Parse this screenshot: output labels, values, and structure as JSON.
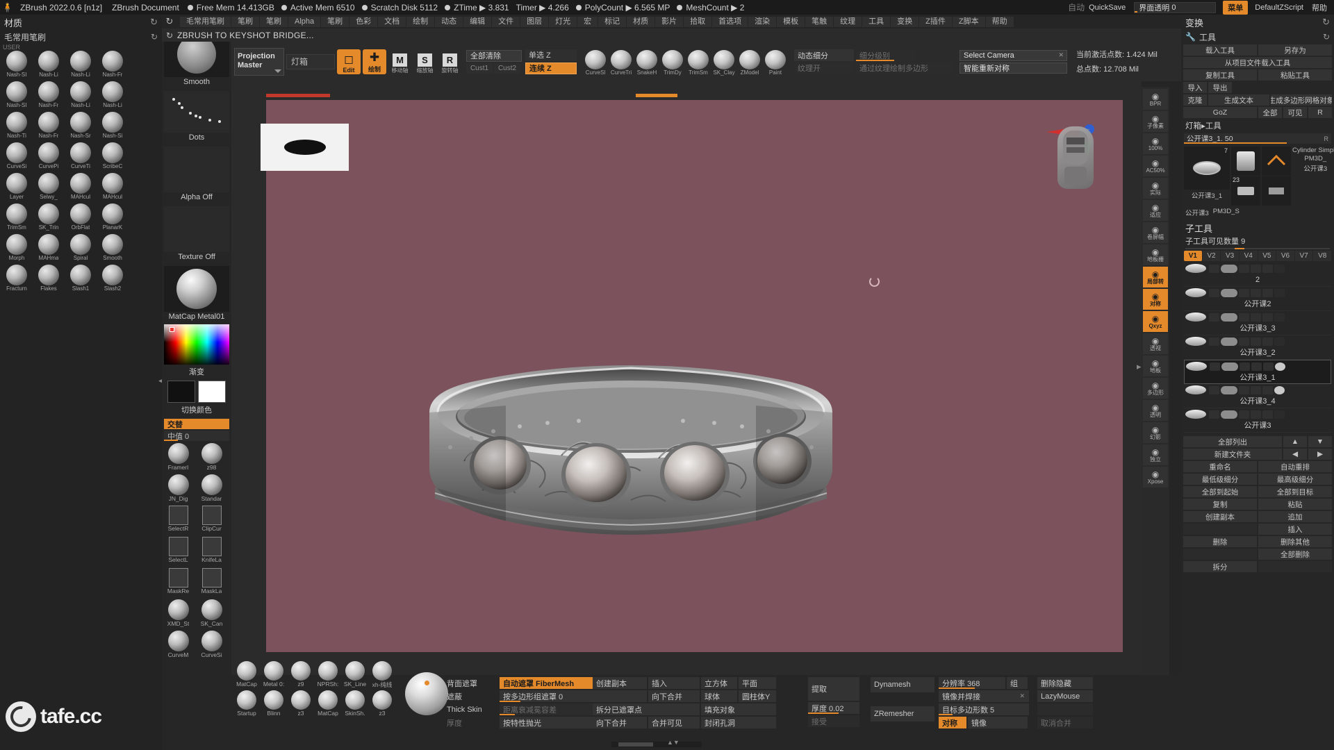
{
  "titlebar": {
    "logo_icon": "zbrush-logo-icon",
    "app_version": "ZBrush 2022.0.6 [n1z]",
    "document_name": "ZBrush Document",
    "stats": [
      {
        "label": "Free Mem",
        "value": "14.413GB"
      },
      {
        "label": "Active Mem",
        "value": "6510"
      },
      {
        "label": "Scratch Disk",
        "value": "5112"
      },
      {
        "label": "ZTime",
        "value": "3.831"
      },
      {
        "label": "Timer",
        "value": "4.266"
      },
      {
        "label": "PolyCount",
        "value": "6.565 MP"
      },
      {
        "label": "MeshCount",
        "value": "2"
      }
    ],
    "auto_label": "自动",
    "quicksave_label": "QuickSave",
    "transparency_label": "界面透明",
    "transparency_value": "0",
    "menu_button": "菜单",
    "default_script": "DefaultZScript",
    "help_label": "帮助"
  },
  "menubar": {
    "reload_icon": "reload-icon",
    "items": [
      "毛常用笔刷",
      "笔刷",
      "笔刷",
      "Alpha",
      "笔刷",
      "色彩",
      "文档",
      "绘制",
      "动态",
      "编辑",
      "文件",
      "图层",
      "灯光",
      "宏",
      "标记",
      "材质",
      "影片",
      "拾取",
      "首选项",
      "渲染",
      "模板",
      "笔触",
      "纹理",
      "工具",
      "变换",
      "Z插件",
      "Z脚本",
      "帮助"
    ]
  },
  "left_panel": {
    "header_title": "材质",
    "header_spin_icon": "refresh-icon",
    "sub_title": "毛常用笔刷",
    "sub_spin_icon": "refresh-icon",
    "user_label": "USER",
    "brushes": [
      {
        "label": "Nash-SI",
        "shape": "sphere"
      },
      {
        "label": "Nash-Li",
        "shape": "sphere"
      },
      {
        "label": "Nash-Li",
        "shape": "sphere"
      },
      {
        "label": "Nash-Fr",
        "shape": "sphere"
      },
      {
        "label": "Nash-SI",
        "shape": "sphere"
      },
      {
        "label": "Nash-Fr",
        "shape": "sphere"
      },
      {
        "label": "Nash-Li",
        "shape": "sphere"
      },
      {
        "label": "Nash-Li",
        "shape": "sphere"
      },
      {
        "label": "Nash-Ti",
        "shape": "sphere"
      },
      {
        "label": "Nash-Fr",
        "shape": "sphere"
      },
      {
        "label": "Nash-Sr",
        "shape": "sphere"
      },
      {
        "label": "Nash-Si",
        "shape": "sphere"
      },
      {
        "label": "CurveSi",
        "shape": "sphere"
      },
      {
        "label": "CurvePi",
        "shape": "sphere"
      },
      {
        "label": "CurveTi",
        "shape": "sphere"
      },
      {
        "label": "ScribeC",
        "shape": "sphere"
      },
      {
        "label": "Layer",
        "shape": "sphere"
      },
      {
        "label": "Selwy_",
        "shape": "sphere"
      },
      {
        "label": "MAHcul",
        "shape": "sphere"
      },
      {
        "label": "MAHcul",
        "shape": "sphere"
      },
      {
        "label": "TrimSm",
        "shape": "sphere"
      },
      {
        "label": "SK_Trin",
        "shape": "sphere"
      },
      {
        "label": "OrbFlat",
        "shape": "sphere"
      },
      {
        "label": "PlanarK",
        "shape": "sphere"
      },
      {
        "label": "Morph",
        "shape": "sphere"
      },
      {
        "label": "MAHma",
        "shape": "sphere"
      },
      {
        "label": "Spiral",
        "shape": "sphere"
      },
      {
        "label": "Smooth",
        "shape": "sphere"
      },
      {
        "label": "Fracturn",
        "shape": "sphere"
      },
      {
        "label": "Flakes",
        "shape": "sphere"
      },
      {
        "label": "Slash1",
        "shape": "sphere"
      },
      {
        "label": "Slash2",
        "shape": "sphere"
      }
    ]
  },
  "tool_col": {
    "smooth_label": "Smooth",
    "dots_label": "Dots",
    "alpha_label": "Alpha Off",
    "texture_label": "Texture Off",
    "matcap_label": "MatCap Metal01",
    "gradient_label": "渐变",
    "switch_color_label": "切换颜色",
    "alternate_label": "交替",
    "mid_label": "中值 0",
    "small_items": [
      {
        "label": "FramerI",
        "shape": "sphere"
      },
      {
        "label": "z98",
        "shape": "sphere"
      },
      {
        "label": "JN_Dig",
        "shape": "sphere"
      },
      {
        "label": "Standar",
        "shape": "sphere"
      },
      {
        "label": "SelectR",
        "shape": "square"
      },
      {
        "label": "ClipCur",
        "shape": "square"
      },
      {
        "label": "SelectL",
        "shape": "square"
      },
      {
        "label": "KnifeLa",
        "shape": "square"
      },
      {
        "label": "MaskRe",
        "shape": "square"
      },
      {
        "label": "MaskLa",
        "shape": "square"
      },
      {
        "label": "XMD_St",
        "shape": "sphere"
      },
      {
        "label": "SK_Can",
        "shape": "sphere"
      },
      {
        "label": "CurveM",
        "shape": "sphere"
      },
      {
        "label": "CurveSi",
        "shape": "sphere"
      }
    ]
  },
  "toolbar2": {
    "subhead_text": "ZBRUSH TO KEYSHOT BRIDGE...",
    "reload_icon": "reload-icon",
    "projection_master": "Projection\nMaster",
    "lightbox_label": "灯箱",
    "edit_label": "Edit",
    "draw_label": "绘制",
    "move_label": "移动轴",
    "scale_label": "缩放轴",
    "rotate_label": "旋转轴",
    "move_glyph": "M",
    "scale_glyph": "S",
    "rotate_glyph": "R",
    "clear_all": "全部清除",
    "cust1": "Cust1",
    "cust2": "Cust2",
    "single_z": "单选 Z",
    "continuous_z": "连续 Z",
    "brush_icons": [
      {
        "label": "CurveSl"
      },
      {
        "label": "CurveTri"
      },
      {
        "label": "SnakeH"
      },
      {
        "label": "TrimDy"
      },
      {
        "label": "TrimSm"
      },
      {
        "label": "SK_Clay"
      },
      {
        "label": "ZModel"
      },
      {
        "label": "Paint"
      }
    ],
    "dynamic_subdiv": "动态细分",
    "subdiv_level": "细分级别",
    "texture_on": "纹理开",
    "edge_loop_hint": "通过纹理绘制多边形",
    "select_camera": "Select Camera",
    "smart_resym": "智能重新对称",
    "active_points_label": "当前激活点数:",
    "active_points_value": "1.424 Mil",
    "total_points_label": "总点数:",
    "total_points_value": "12.708 Mil"
  },
  "canvas": {
    "alpha_preview_name": "alpha-preview",
    "gizmo_name": "orientation-gizmo",
    "head_ref_name": "head-reference-thumbnail",
    "cursor_name": "brush-cursor",
    "background_color": "#7c525c",
    "object_name": "ornate-silver-ring"
  },
  "icon_strip": {
    "items": [
      {
        "icon": "bpr-icon",
        "label": "BPR"
      },
      {
        "icon": "pixel-icon",
        "label": "子像素"
      },
      {
        "icon": "zoom100-icon",
        "label": "100%"
      },
      {
        "icon": "zoom50-icon",
        "label": "AC50%"
      },
      {
        "icon": "actual-icon",
        "label": "实际"
      },
      {
        "icon": "frame-icon",
        "label": "适应"
      },
      {
        "icon": "scroll-icon",
        "label": "卷屏幅"
      },
      {
        "icon": "grid-icon",
        "label": "地板栅"
      },
      {
        "icon": "local-icon",
        "label": "局部转",
        "active": true
      },
      {
        "icon": "symmetry-icon",
        "label": "对称",
        "active": true
      },
      {
        "icon": "xyz-icon",
        "label": "Qxyz",
        "active": true
      },
      {
        "icon": "persp-icon",
        "label": "透视"
      },
      {
        "icon": "floor-icon",
        "label": "地板"
      },
      {
        "icon": "polyf-icon",
        "label": "多边形"
      },
      {
        "icon": "trans-icon",
        "label": "透明"
      },
      {
        "icon": "ghost-icon",
        "label": "幻影"
      },
      {
        "icon": "solo-icon",
        "label": "独立"
      },
      {
        "icon": "xpose-icon",
        "label": "Xpose"
      }
    ]
  },
  "right_panel": {
    "header_title": "变换",
    "header_spin_icon": "refresh-icon",
    "sub_title": "工具",
    "sub_icon": "wrench-icon",
    "rows": [
      [
        "载入工具",
        "另存为"
      ],
      [
        "从项目文件载入工具"
      ],
      [
        "复制工具",
        "粘贴工具"
      ],
      [
        "导入",
        "导出"
      ],
      [
        "克隆",
        "生成文本",
        "生成多边形网格对象"
      ],
      [
        "GoZ",
        "全部",
        "可见",
        "R"
      ]
    ],
    "lightbox_tool": "灯箱▸工具",
    "current_tool_name": "公开课3_1. 50",
    "current_tool_r": "R",
    "thumb_number": "7",
    "thumbs": [
      {
        "caption": "公开课3_1",
        "num": "7"
      },
      {
        "caption": "Cylinder Simple"
      },
      {
        "caption": "PM3D_",
        "num": "23"
      },
      {
        "caption": "公开课3"
      },
      {
        "caption": "公开课3",
        "num": "7"
      },
      {
        "caption": "PM3D_S"
      }
    ],
    "subtool_title": "子工具",
    "subtool_count_label": "子工具可见数量",
    "subtool_count_value": "9",
    "vtabs": [
      "V1",
      "V2",
      "V3",
      "V4",
      "V5",
      "V6",
      "V7",
      "V8"
    ],
    "subtools": [
      {
        "name": "2",
        "selected": false,
        "eye": false
      },
      {
        "name": "公开课2",
        "selected": false,
        "eye": false
      },
      {
        "name": "公开课3_3",
        "selected": false,
        "eye": false
      },
      {
        "name": "公开课3_2",
        "selected": false,
        "eye": false
      },
      {
        "name": "公开课3_1",
        "selected": true,
        "eye": true
      },
      {
        "name": "公开课3_4",
        "selected": false,
        "eye": true
      },
      {
        "name": "公开课3",
        "selected": false,
        "eye": false
      }
    ],
    "bottom_rows": [
      [
        "全部列出",
        "▲",
        "▼"
      ],
      [
        "新建文件夹",
        "◀",
        "▶"
      ],
      [
        "重命名",
        "自动重排"
      ],
      [
        "最低级细分",
        "最高级细分"
      ],
      [
        "全部到起始",
        "全部到目标"
      ],
      [
        "复制",
        "粘贴"
      ],
      [
        "创建副本",
        "追加"
      ],
      [
        "",
        "插入"
      ],
      [
        "删除",
        "删除其他"
      ],
      [
        "",
        "全部删除"
      ],
      [
        "拆分",
        ""
      ]
    ]
  },
  "bottom_panel": {
    "materials": [
      {
        "label": "MatCap"
      },
      {
        "label": "Metal 0:"
      },
      {
        "label": "z9"
      },
      {
        "label": "NPRSh:"
      },
      {
        "label": "SK_Line"
      },
      {
        "label": "xh-纯线"
      }
    ],
    "materials2": [
      {
        "label": "Startup"
      },
      {
        "label": "Blinn"
      },
      {
        "label": "z3"
      },
      {
        "label": "MatCap"
      },
      {
        "label": "SkinSh."
      },
      {
        "label": "z3"
      }
    ],
    "col1": [
      {
        "label": "背面遮罩",
        "field": "自动遮罩 FiberMesh",
        "orange": true
      },
      {
        "label": "遮蔽",
        "field": "按多边形组遮罩 0",
        "fill": 30
      },
      {
        "label": "Thick Skin",
        "field": "距离衰减冕容差",
        "dim": true
      },
      {
        "label": "厚度",
        "field": "按特性抛光",
        "dim_label": true
      }
    ],
    "col2": [
      {
        "b1": "创建副本",
        "b2": "插入",
        "b3": "立方体",
        "b4": "平面"
      },
      {
        "b1": "",
        "b2": "向下合并",
        "b3": "球体",
        "b4": "圆柱体Y"
      },
      {
        "b1": "拆分已遮罩点",
        "b2": "",
        "b3": "填充对象",
        "b4": ""
      },
      {
        "b1": "向下合并",
        "b2": "",
        "b3": "合并可见",
        "b4": "封闭孔洞"
      }
    ],
    "col3": [
      {
        "label": "提取"
      },
      {
        "label": "厚度 0.02",
        "slider": true
      },
      {
        "label": "接受",
        "dim": true
      }
    ],
    "col4": [
      {
        "label": "Dynamesh"
      },
      {
        "label": "ZRemesher"
      }
    ],
    "col5": [
      {
        "label": "分辨率 368",
        "extra": "组"
      },
      {
        "label": "镜像并焊接",
        "icon": "x"
      },
      {
        "label": "目标多边形数 5"
      },
      {
        "label": "对称",
        "pill": true
      },
      {
        "label": "镜像"
      }
    ],
    "col6": [
      {
        "label": "删除隐藏"
      },
      {
        "label": "LazyMouse"
      },
      {
        "label": ""
      },
      {
        "label": "取消合并"
      }
    ],
    "watermark": "tafe.cc",
    "watermark_icon": "tafe-logo-icon"
  }
}
